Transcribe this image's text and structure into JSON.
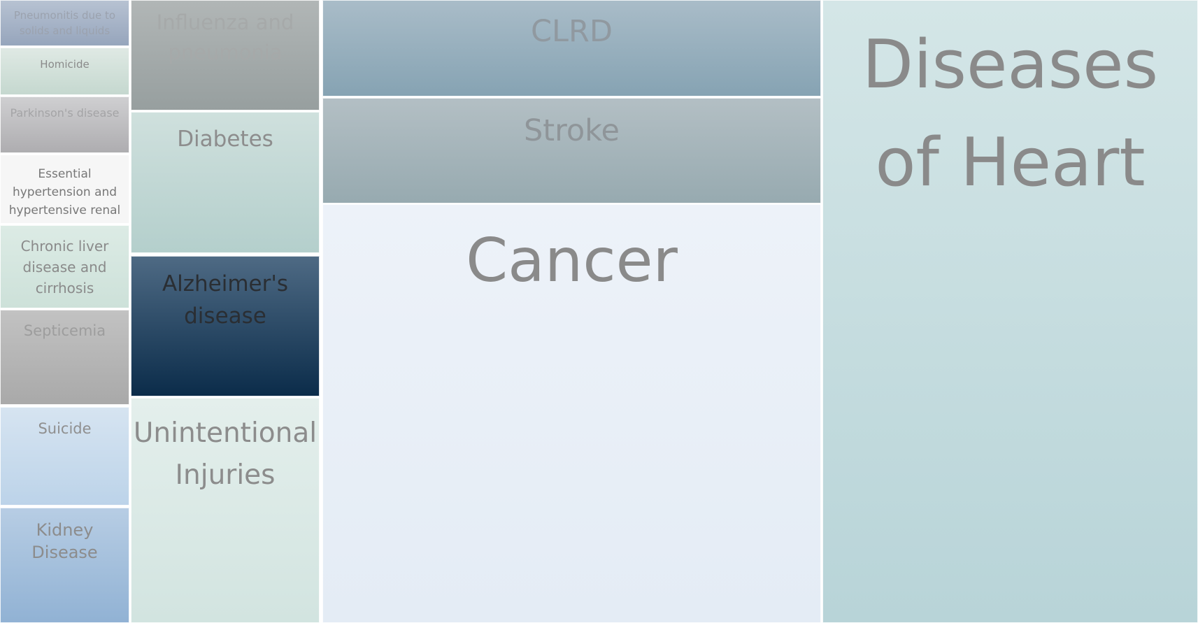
{
  "treemap": {
    "tiles": [
      {
        "label": "Pneumonitis due to solids and liquids"
      },
      {
        "label": "Homicide"
      },
      {
        "label": "Parkinson's disease"
      },
      {
        "label": "Essential hypertension and hypertensive renal"
      },
      {
        "label": "Chronic liver disease and cirrhosis"
      },
      {
        "label": "Septicemia"
      },
      {
        "label": "Suicide"
      },
      {
        "label": "Kidney Disease"
      },
      {
        "label": "Influenza and pneumonia"
      },
      {
        "label": "Diabetes"
      },
      {
        "label": "Alzheimer's disease"
      },
      {
        "label": "Unintentional Injuries"
      },
      {
        "label": "CLRD"
      },
      {
        "label": "Stroke"
      },
      {
        "label": "Cancer"
      },
      {
        "label": "Diseases of Heart"
      }
    ]
  },
  "colors": {
    "highlighted_tile": "#0b2c4a",
    "label_text": "#8a8a8a",
    "tile_border": "#ffffff"
  }
}
